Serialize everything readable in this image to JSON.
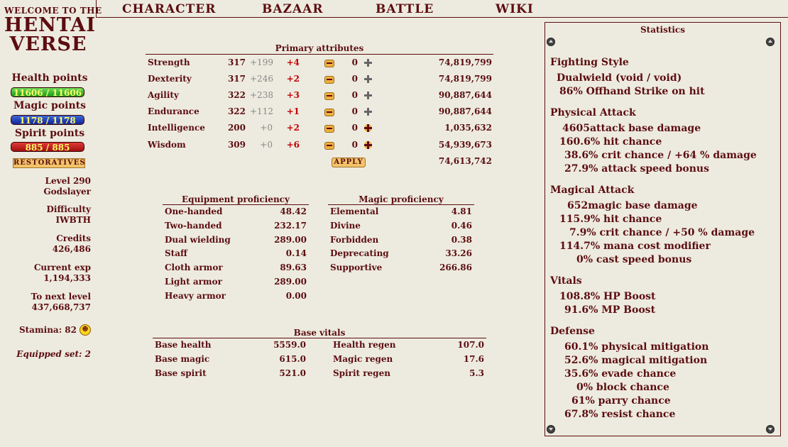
{
  "logo": {
    "welcome": "WELCOME TO THE",
    "line1": "HENTAI",
    "line2": "VERSE"
  },
  "vitals": {
    "health_label": "Health points",
    "health_value": "11606 / 11606",
    "magic_label": "Magic points",
    "magic_value": "1178 / 1178",
    "spirit_label": "Spirit points",
    "spirit_value": "885 / 885",
    "restoratives": "RESTORATIVES"
  },
  "character": {
    "level": "Level 290",
    "title": "Godslayer",
    "difficulty_label": "Difficulty",
    "difficulty": "IWBTH",
    "credits_label": "Credits",
    "credits": "426,486",
    "exp_label": "Current exp",
    "exp": "1,194,333",
    "next_label": "To next level",
    "next": "437,668,737",
    "stamina": "Stamina: 82",
    "stamina_icon": "smiley-icon",
    "equipped_set": "Equipped set: 2"
  },
  "nav": {
    "items": [
      "CHARACTER",
      "BAZAAR",
      "BATTLE",
      "WIKI"
    ]
  },
  "primary": {
    "title": "Primary attributes",
    "rows": [
      {
        "name": "Strength",
        "base": "317",
        "bonus": "+199",
        "mod": "+4",
        "alloc": "0",
        "plus_active": false,
        "cost": "74,819,799"
      },
      {
        "name": "Dexterity",
        "base": "317",
        "bonus": "+246",
        "mod": "+2",
        "alloc": "0",
        "plus_active": false,
        "cost": "74,819,799"
      },
      {
        "name": "Agility",
        "base": "322",
        "bonus": "+238",
        "mod": "+3",
        "alloc": "0",
        "plus_active": false,
        "cost": "90,887,644"
      },
      {
        "name": "Endurance",
        "base": "322",
        "bonus": "+112",
        "mod": "+1",
        "alloc": "0",
        "plus_active": false,
        "cost": "90,887,644"
      },
      {
        "name": "Intelligence",
        "base": "200",
        "bonus": "+0",
        "mod": "+2",
        "alloc": "0",
        "plus_active": true,
        "cost": "1,035,632"
      },
      {
        "name": "Wisdom",
        "base": "309",
        "bonus": "+0",
        "mod": "+6",
        "alloc": "0",
        "plus_active": true,
        "cost": "54,939,673"
      }
    ],
    "apply": "APPLY",
    "total_cost": "74,613,742"
  },
  "equipment": {
    "title": "Equipment proficiency",
    "rows": [
      {
        "name": "One-handed",
        "value": "48.42"
      },
      {
        "name": "Two-handed",
        "value": "232.17"
      },
      {
        "name": "Dual wielding",
        "value": "289.00"
      },
      {
        "name": "Staff",
        "value": "0.14"
      },
      {
        "name": "Cloth armor",
        "value": "89.63"
      },
      {
        "name": "Light armor",
        "value": "289.00"
      },
      {
        "name": "Heavy armor",
        "value": "0.00"
      }
    ]
  },
  "magic": {
    "title": "Magic proficiency",
    "rows": [
      {
        "name": "Elemental",
        "value": "4.81"
      },
      {
        "name": "Divine",
        "value": "0.46"
      },
      {
        "name": "Forbidden",
        "value": "0.38"
      },
      {
        "name": "Deprecating",
        "value": "33.26"
      },
      {
        "name": "Supportive",
        "value": "266.86"
      }
    ]
  },
  "base_vitals": {
    "title": "Base vitals",
    "rows": [
      {
        "name": "Base health",
        "value": "5559.0",
        "name2": "Health regen",
        "value2": "107.0"
      },
      {
        "name": "Base magic",
        "value": "615.0",
        "name2": "Magic regen",
        "value2": "17.6"
      },
      {
        "name": "Base spirit",
        "value": "521.0",
        "name2": "Spirit regen",
        "value2": "5.3"
      }
    ]
  },
  "statistics": {
    "title": "Statistics",
    "fighting_style": {
      "heading": "Fighting Style",
      "line1": "Dualwield (void / void)",
      "line2": "86% Offhand Strike on hit"
    },
    "physical": {
      "heading": "Physical Attack",
      "lines": [
        "4605attack base damage",
        "160.6% hit chance",
        "38.6% crit chance / +64 % damage",
        "27.9% attack speed bonus"
      ]
    },
    "magical": {
      "heading": "Magical Attack",
      "lines": [
        "652magic base damage",
        "115.9% hit chance",
        "7.9% crit chance / +50 % damage",
        "114.7% mana cost modifier",
        "0% cast speed bonus"
      ]
    },
    "vitals": {
      "heading": "Vitals",
      "lines": [
        "108.8% HP Boost",
        "91.6% MP Boost"
      ]
    },
    "defense": {
      "heading": "Defense",
      "lines": [
        "60.1% physical mitigation",
        "52.6% magical mitigation",
        "35.6% evade chance",
        "0% block chance",
        "61% parry chance",
        "67.8% resist chance"
      ]
    }
  }
}
